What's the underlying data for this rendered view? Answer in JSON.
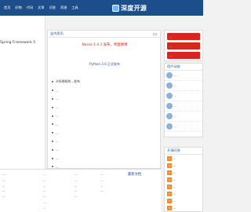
{
  "nav": {
    "items": [
      "首页",
      "好物",
      "代码",
      "文章",
      "问答",
      "资源",
      "工具"
    ]
  },
  "brand": {
    "name": "深度开源"
  },
  "left": {
    "title": "Spring Framework 5"
  },
  "news": {
    "header": "业内资讯",
    "more": "更多",
    "headline1": "Nacos 1.4.1 发布，修复故障",
    "headline2": "Python 3.0 正式发布",
    "items": [
      "众所周知的...发布",
      "...",
      "...",
      "...",
      "...",
      "...",
      "...",
      "...",
      "...",
      "...",
      "..."
    ]
  },
  "sidebar": {
    "buttons": [
      "...",
      "...",
      "..."
    ]
  },
  "users": {
    "header": "用户动态",
    "rows": [
      "...",
      "...",
      "...",
      "...",
      "...",
      "..."
    ]
  },
  "hot": {
    "header": "开源问答",
    "rows": [
      "...",
      "...",
      "...",
      "...",
      "...",
      "...",
      "...",
      "..."
    ]
  },
  "bottom": {
    "col1": {
      "title": "...",
      "links": [
        "...",
        "...",
        "...",
        "..."
      ]
    },
    "col2": {
      "title": "...",
      "links": [
        "...",
        "...",
        "...",
        "..."
      ],
      "sub": "...",
      "links2": [
        "...",
        "..."
      ]
    },
    "col3": {
      "title": "...",
      "links": [
        "...",
        "...",
        "...",
        "..."
      ]
    },
    "col4": {
      "title": "...",
      "links": [
        "...",
        "...",
        "..."
      ]
    }
  },
  "latest": {
    "header": "最新文档"
  },
  "colors": {
    "nav_bg": "#1d4e8c",
    "accent_red": "#d9261c",
    "accent_orange": "#f28b2d"
  }
}
